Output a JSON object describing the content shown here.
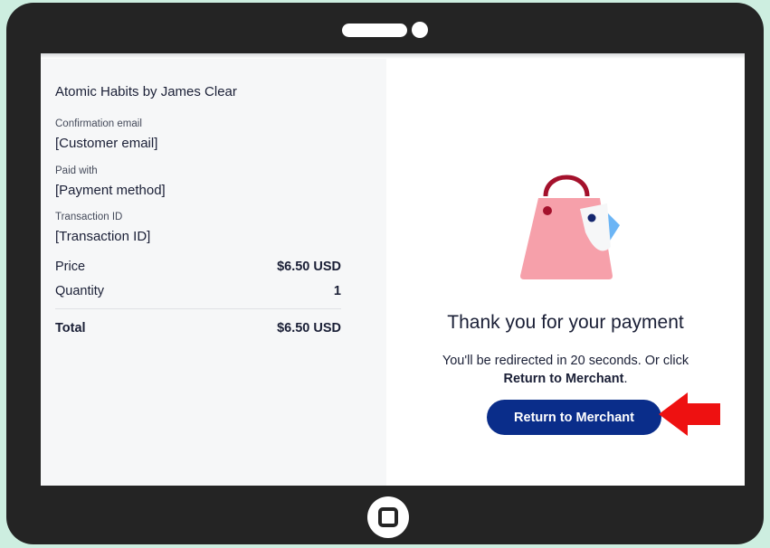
{
  "order": {
    "product_title": "Atomic Habits by James Clear",
    "confirmation_email_label": "Confirmation email",
    "confirmation_email_value": "[Customer email]",
    "paid_with_label": "Paid with",
    "paid_with_value": "[Payment method]",
    "transaction_id_label": "Transaction ID",
    "transaction_id_value": "[Transaction ID]",
    "price_label": "Price",
    "price_value": "$6.50 USD",
    "quantity_label": "Quantity",
    "quantity_value": "1",
    "total_label": "Total",
    "total_value": "$6.50 USD"
  },
  "confirmation": {
    "heading": "Thank you for your payment",
    "redirect_text": "You'll be redirected in 20 seconds. Or click",
    "redirect_link_text": "Return to Merchant",
    "redirect_end": ".",
    "button_label": "Return to Merchant"
  },
  "icons": {
    "bag": "shopping-bag-icon",
    "arrow": "red-arrow-left-icon",
    "home": "home-button-icon"
  },
  "colors": {
    "button": "#0a2d8a",
    "arrow": "#ee1111",
    "bag": "#f6a0aa",
    "frame": "#242424",
    "backdrop": "#cdeee0"
  }
}
